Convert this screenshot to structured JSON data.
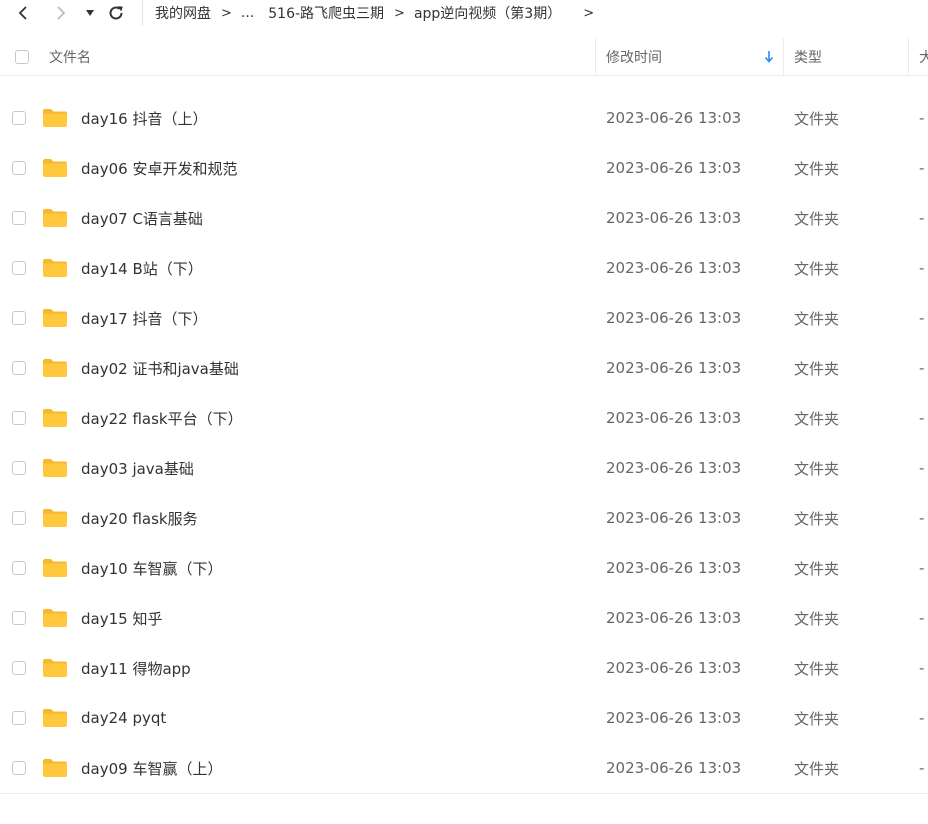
{
  "nav": {
    "back_icon": "chevron-left-icon",
    "forward_icon": "chevron-right-icon",
    "dropdown_icon": "caret-down-icon",
    "refresh_icon": "refresh-icon"
  },
  "breadcrumb": {
    "items": [
      "我的网盘",
      "...",
      "516-路飞爬虫三期",
      "app逆向视频（第3期）"
    ],
    "separator": ">"
  },
  "table": {
    "columns": {
      "name": "文件名",
      "modified": "修改时间",
      "type": "类型",
      "size": "大"
    },
    "sort_icon": "arrow-down-icon",
    "rows": [
      {
        "name": "day16 抖音（上）",
        "modified": "2023-06-26 13:03",
        "type": "文件夹",
        "size": "-"
      },
      {
        "name": "day06 安卓开发和规范",
        "modified": "2023-06-26 13:03",
        "type": "文件夹",
        "size": "-"
      },
      {
        "name": "day07 C语言基础",
        "modified": "2023-06-26 13:03",
        "type": "文件夹",
        "size": "-"
      },
      {
        "name": "day14 B站（下）",
        "modified": "2023-06-26 13:03",
        "type": "文件夹",
        "size": "-"
      },
      {
        "name": "day17 抖音（下）",
        "modified": "2023-06-26 13:03",
        "type": "文件夹",
        "size": "-"
      },
      {
        "name": "day02 证书和java基础",
        "modified": "2023-06-26 13:03",
        "type": "文件夹",
        "size": "-"
      },
      {
        "name": "day22 flask平台（下）",
        "modified": "2023-06-26 13:03",
        "type": "文件夹",
        "size": "-"
      },
      {
        "name": "day03 java基础",
        "modified": "2023-06-26 13:03",
        "type": "文件夹",
        "size": "-"
      },
      {
        "name": "day20 flask服务",
        "modified": "2023-06-26 13:03",
        "type": "文件夹",
        "size": "-"
      },
      {
        "name": "day10 车智赢（下）",
        "modified": "2023-06-26 13:03",
        "type": "文件夹",
        "size": "-"
      },
      {
        "name": "day15 知乎",
        "modified": "2023-06-26 13:03",
        "type": "文件夹",
        "size": "-"
      },
      {
        "name": "day11 得物app",
        "modified": "2023-06-26 13:03",
        "type": "文件夹",
        "size": "-"
      },
      {
        "name": "day24 pyqt",
        "modified": "2023-06-26 13:03",
        "type": "文件夹",
        "size": "-"
      },
      {
        "name": "day09 车智赢（上）",
        "modified": "2023-06-26 13:03",
        "type": "文件夹",
        "size": "-"
      }
    ]
  },
  "colors": {
    "folder": "#FFC83D",
    "folder_back": "#F5B82E",
    "sort_arrow": "#2C8CF0",
    "border": "#EBEBEB"
  }
}
